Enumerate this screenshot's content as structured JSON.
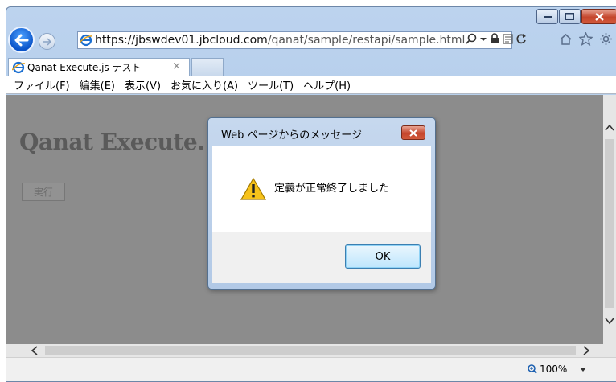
{
  "browser": {
    "url_prefix": "https://jbswdev01.",
    "url_domain": "jbcloud.com",
    "url_path": "/qanat/sample/restapi/sample.html",
    "tab_title": "Qanat Execute.js テスト",
    "tab_close": "×"
  },
  "menu": {
    "file": "ファイル(F)",
    "edit": "編集(E)",
    "view": "表示(V)",
    "favorites": "お気に入り(A)",
    "tools": "ツール(T)",
    "help": "ヘルプ(H)"
  },
  "page": {
    "title": "Qanat Execute.",
    "run_button": "実行"
  },
  "dialog": {
    "title": "Web ページからのメッセージ",
    "message": "定義が正常終了しました",
    "ok_label": "OK"
  },
  "status": {
    "zoom": "100%"
  }
}
